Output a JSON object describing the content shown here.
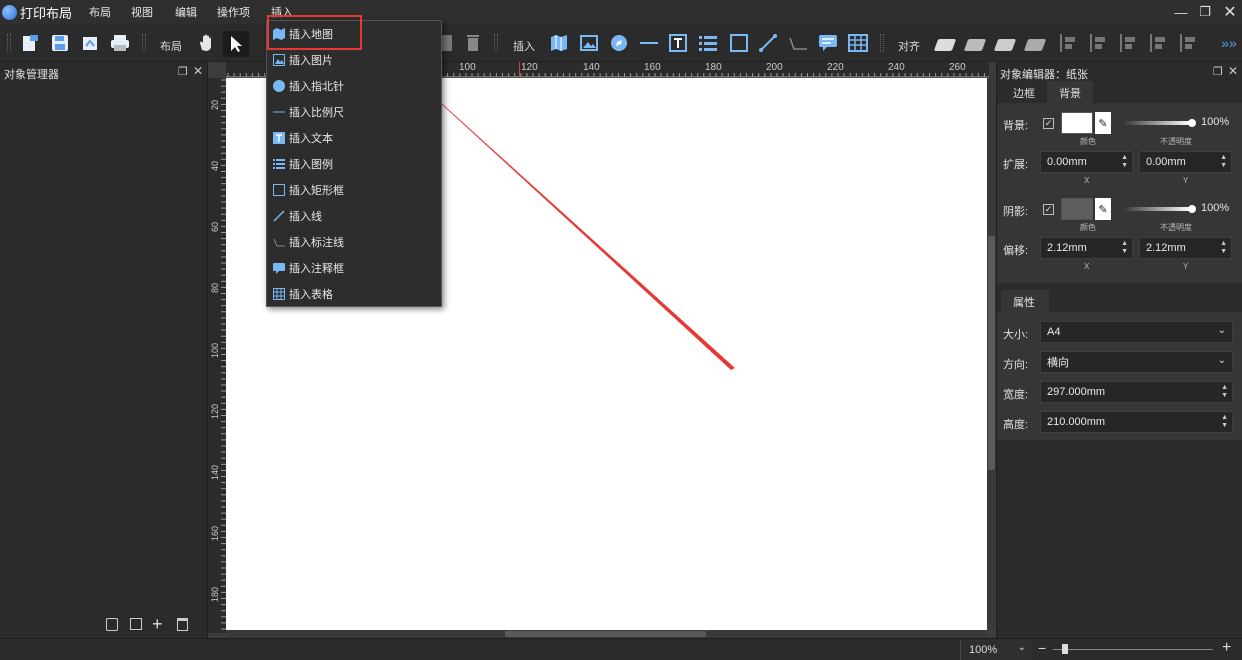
{
  "app": {
    "title": "打印布局"
  },
  "menubar": [
    "布局",
    "视图",
    "编辑",
    "操作项",
    "插入"
  ],
  "toolbar": {
    "layout_label": "布局",
    "insert_label": "插入",
    "align_label": "对齐"
  },
  "left_panel": {
    "title": "对象管理器"
  },
  "ruler": {
    "top_ticks": [
      "100",
      "120",
      "140",
      "160",
      "180",
      "200",
      "220",
      "240",
      "260"
    ],
    "left_ticks": [
      "20",
      "40",
      "60",
      "80",
      "100",
      "120",
      "140",
      "160",
      "180"
    ]
  },
  "dropdown": {
    "items": [
      {
        "label": "插入地图",
        "icon": "map-icon"
      },
      {
        "label": "插入图片",
        "icon": "image-icon"
      },
      {
        "label": "插入指北针",
        "icon": "compass-icon"
      },
      {
        "label": "插入比例尺",
        "icon": "scalebar-icon"
      },
      {
        "label": "插入文本",
        "icon": "text-icon"
      },
      {
        "label": "插入图例",
        "icon": "legend-icon"
      },
      {
        "label": "插入矩形框",
        "icon": "rectangle-icon"
      },
      {
        "label": "插入线",
        "icon": "line-icon"
      },
      {
        "label": "插入标注线",
        "icon": "callout-line-icon"
      },
      {
        "label": "插入注释框",
        "icon": "comment-icon"
      },
      {
        "label": "插入表格",
        "icon": "table-icon"
      }
    ]
  },
  "right_panel": {
    "title": "对象编辑器：纸张",
    "tabs": [
      "边框",
      "背景"
    ],
    "background": {
      "label": "背景:",
      "color_caption": "颜色",
      "opacity_caption": "不透明度",
      "opacity": "100%"
    },
    "extend": {
      "label": "扩展:",
      "x": "0.00mm",
      "y": "0.00mm",
      "x_caption": "X",
      "y_caption": "Y"
    },
    "shadow": {
      "label": "阴影:",
      "color_caption": "颜色",
      "opacity_caption": "不透明度",
      "opacity": "100%"
    },
    "offset": {
      "label": "偏移:",
      "x": "2.12mm",
      "y": "2.12mm",
      "x_caption": "X",
      "y_caption": "Y"
    },
    "props": {
      "title": "属性",
      "size_label": "大小:",
      "size": "A4",
      "orient_label": "方向:",
      "orient": "横向",
      "width_label": "宽度:",
      "width": "297.000mm",
      "height_label": "高度:",
      "height": "210.000mm"
    }
  },
  "status": {
    "zoom": "100%"
  },
  "colors": {
    "accent": "#e53935",
    "icon_blue": "#7ab8f5",
    "swatch_white": "#ffffff",
    "swatch_gray": "#5e5e5e"
  }
}
